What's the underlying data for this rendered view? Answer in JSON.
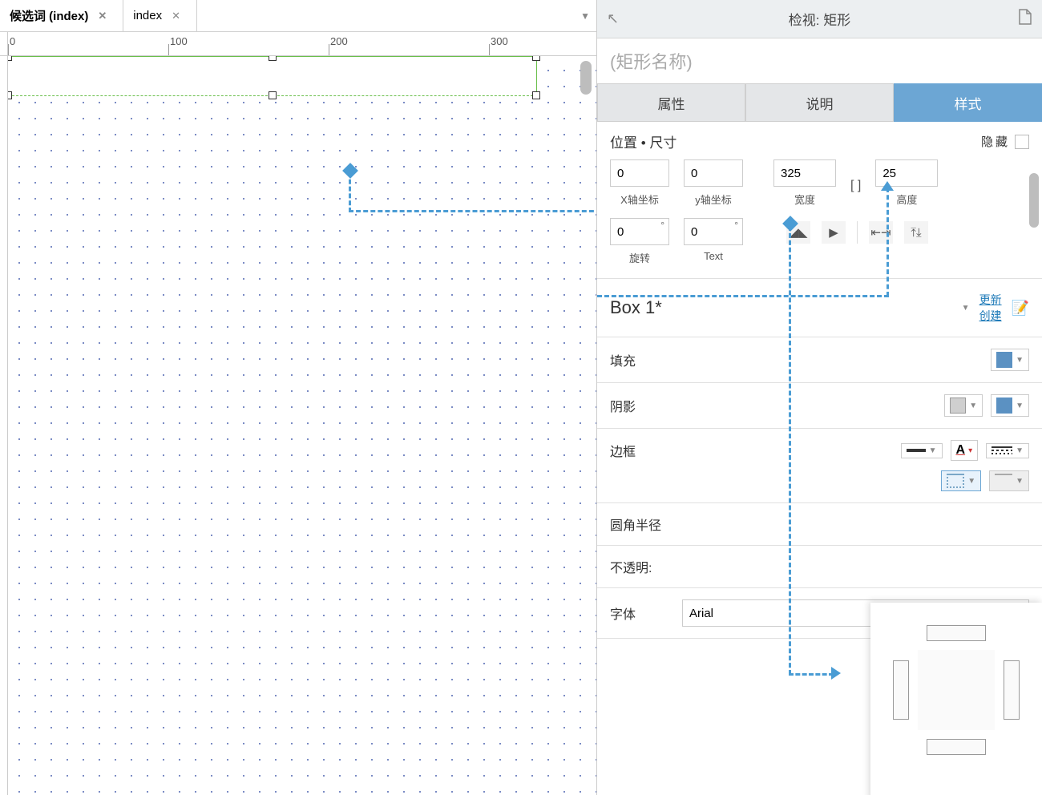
{
  "tabs": {
    "tab1": "候选词 (index)",
    "tab2": "index"
  },
  "ruler": {
    "t0": "0",
    "t100": "100",
    "t200": "200",
    "t300": "300"
  },
  "inspector": {
    "title": "检视: 矩形",
    "name_placeholder": "(矩形名称)",
    "tabs": {
      "prop": "属性",
      "desc": "说明",
      "style": "样式"
    },
    "pos_section": "位置 • 尺寸",
    "hide_label": "隐藏",
    "x_label": "X轴坐标",
    "y_label": "y轴坐标",
    "w_label": "宽度",
    "h_label": "高度",
    "rot_label": "旋转",
    "text_label": "Text",
    "x_val": "0",
    "y_val": "0",
    "w_val": "325",
    "h_val": "25",
    "rot_val": "0",
    "text_val": "0",
    "style_name": "Box 1*",
    "update_link": "更新",
    "create_link": "创建",
    "fill": "填充",
    "shadow": "阴影",
    "border": "边框",
    "radius": "圆角半径",
    "opacity": "不透明:",
    "font": "字体",
    "font_val": "Arial"
  }
}
